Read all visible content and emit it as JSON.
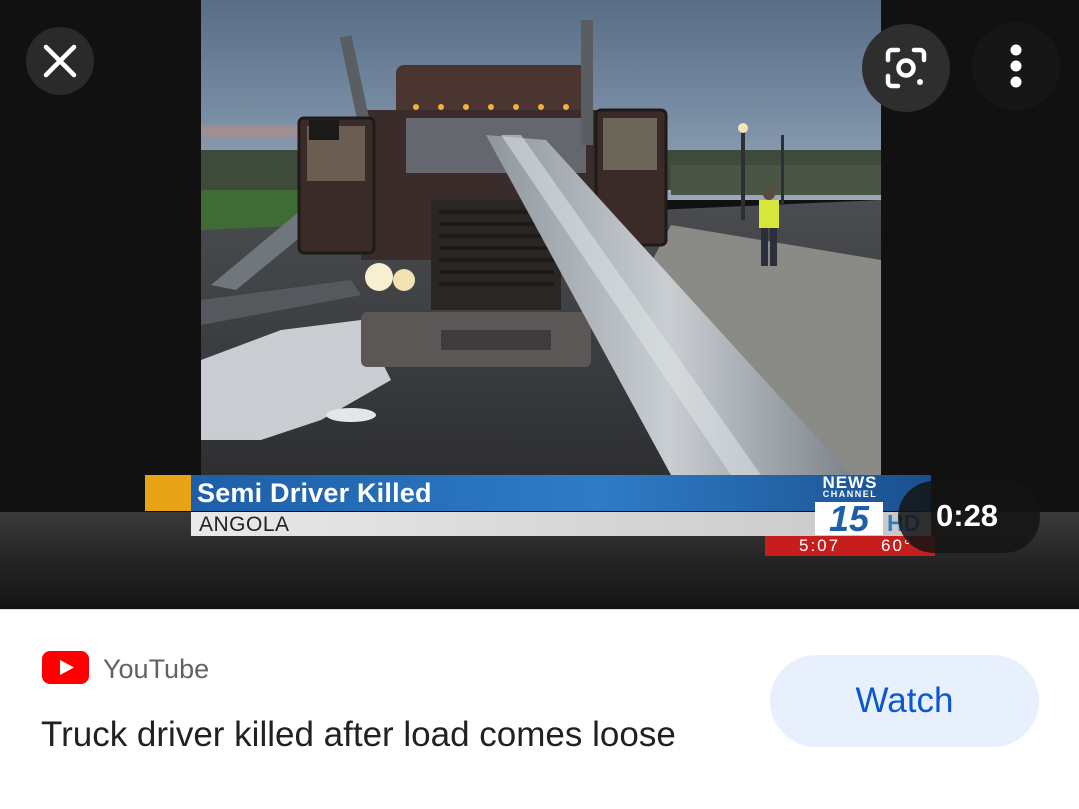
{
  "viewer": {
    "close_icon": "close-icon",
    "lens_icon": "google-lens-icon",
    "more_icon": "more-vertical-icon",
    "duration": "0:28",
    "broadcast": {
      "headline": "Semi Driver Killed",
      "location": "ANGOLA",
      "channel_word": "NEWS",
      "channel_sub": "CHANNEL",
      "channel_number": "15",
      "channel_hd": "HD",
      "time": "5:07",
      "temperature": "60°"
    }
  },
  "result": {
    "source": "YouTube",
    "source_icon": "youtube-icon",
    "title": "Truck driver killed after load comes loose",
    "watch_label": "Watch"
  },
  "colors": {
    "accent": "#0b57d0",
    "watch_bg": "#e8f0fe",
    "youtube_red": "#ff0000"
  }
}
